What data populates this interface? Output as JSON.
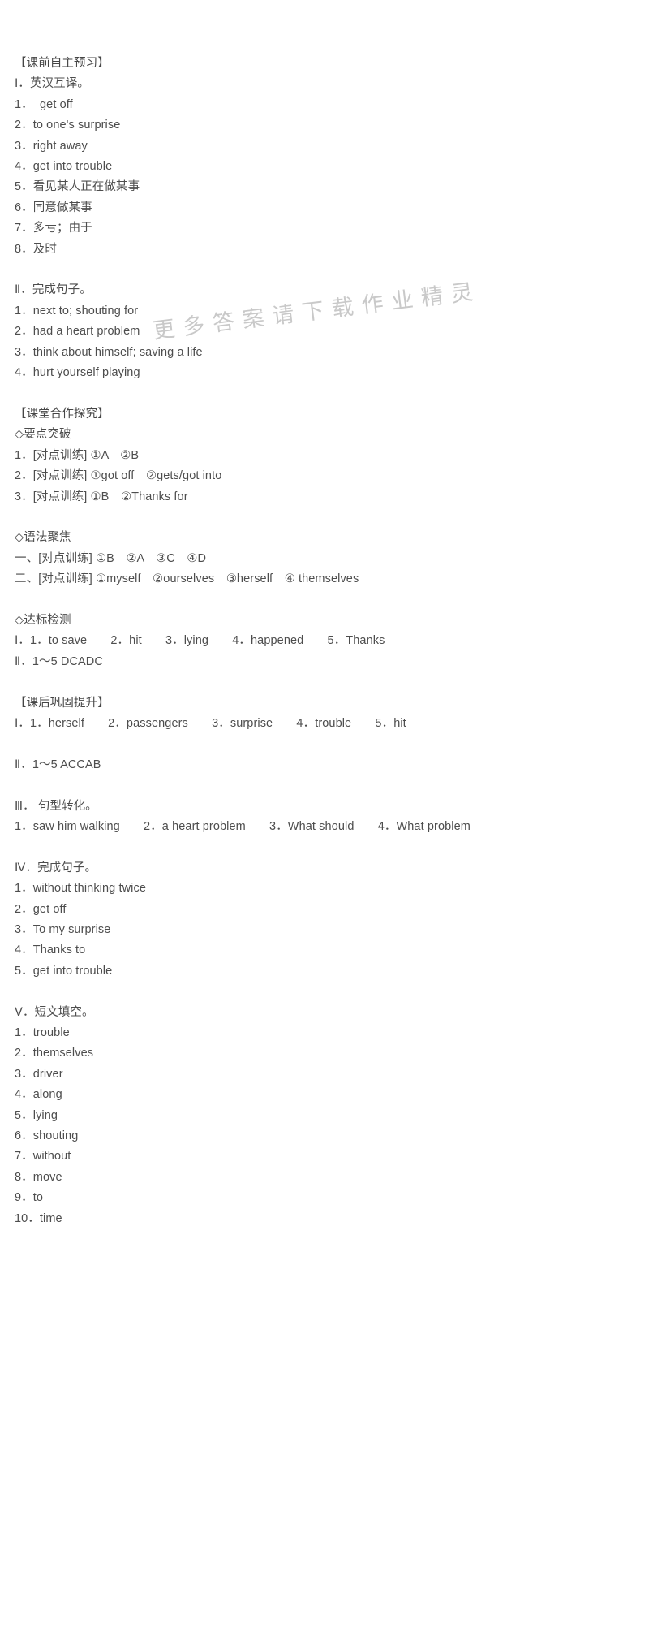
{
  "document": {
    "watermark": "更多答案请下载作业精灵",
    "blocks": [
      {
        "type": "header",
        "text": "【课前自主预习】"
      },
      {
        "type": "sub",
        "text": "Ⅰ．英汉互译。"
      },
      {
        "type": "item",
        "text": "1．  get off"
      },
      {
        "type": "item",
        "text": "2．to one's surprise"
      },
      {
        "type": "item",
        "text": "3．right away"
      },
      {
        "type": "item",
        "text": "4．get into trouble"
      },
      {
        "type": "item",
        "text": "5．看见某人正在做某事"
      },
      {
        "type": "item",
        "text": "6．同意做某事"
      },
      {
        "type": "item",
        "text": "7．多亏；由于"
      },
      {
        "type": "item",
        "text": "8．及时"
      },
      {
        "type": "gap",
        "text": ""
      },
      {
        "type": "sub",
        "text": "Ⅱ．完成句子。"
      },
      {
        "type": "item",
        "text": "1．next to; shouting for"
      },
      {
        "type": "item",
        "text": "2．had a heart problem"
      },
      {
        "type": "item",
        "text": "3．think about himself; saving a life"
      },
      {
        "type": "item",
        "text": "4．hurt yourself playing"
      },
      {
        "type": "gap",
        "text": ""
      },
      {
        "type": "header",
        "text": "【课堂合作探究】"
      },
      {
        "type": "sub",
        "text": "◇要点突破"
      },
      {
        "type": "item",
        "text": "1．[对点训练] ①A　②B"
      },
      {
        "type": "item",
        "text": "2．[对点训练] ①got off　②gets/got into"
      },
      {
        "type": "item",
        "text": "3．[对点训练] ①B　②Thanks for"
      },
      {
        "type": "gap",
        "text": ""
      },
      {
        "type": "sub",
        "text": "◇语法聚焦"
      },
      {
        "type": "item",
        "text": "一、[对点训练] ①B　②A　③C　④D"
      },
      {
        "type": "item",
        "text": "二、[对点训练] ①myself　②ourselves　③herself　④ themselves"
      },
      {
        "type": "gap",
        "text": ""
      },
      {
        "type": "sub",
        "text": "◇达标检测"
      },
      {
        "type": "item",
        "text": "Ⅰ．1．to save　　2．hit　　3．lying　　4．happened　　5．Thanks"
      },
      {
        "type": "item",
        "text": "Ⅱ．1～5 DCADC"
      },
      {
        "type": "gap",
        "text": ""
      },
      {
        "type": "header",
        "text": "【课后巩固提升】"
      },
      {
        "type": "item",
        "text": "Ⅰ．1．herself　　2．passengers　　3．surprise　　4．trouble　　5．hit"
      },
      {
        "type": "gap",
        "text": ""
      },
      {
        "type": "item",
        "text": "Ⅱ．1～5 ACCAB"
      },
      {
        "type": "gap",
        "text": ""
      },
      {
        "type": "sub",
        "text": "Ⅲ． 句型转化。"
      },
      {
        "type": "item",
        "text": "1．saw him walking　　2．a heart problem　　3．What should　　4．What problem"
      },
      {
        "type": "gap",
        "text": ""
      },
      {
        "type": "sub",
        "text": "Ⅳ．完成句子。"
      },
      {
        "type": "item",
        "text": "1．without thinking twice"
      },
      {
        "type": "item",
        "text": "2．get off"
      },
      {
        "type": "item",
        "text": "3．To my surprise"
      },
      {
        "type": "item",
        "text": "4．Thanks to"
      },
      {
        "type": "item",
        "text": "5．get into trouble"
      },
      {
        "type": "gap",
        "text": ""
      },
      {
        "type": "sub",
        "text": "Ⅴ．短文填空。"
      },
      {
        "type": "item",
        "text": "1．trouble"
      },
      {
        "type": "item",
        "text": "2．themselves"
      },
      {
        "type": "item",
        "text": "3．driver"
      },
      {
        "type": "item",
        "text": "4．along"
      },
      {
        "type": "item",
        "text": "5．lying"
      },
      {
        "type": "item",
        "text": "6．shouting"
      },
      {
        "type": "item",
        "text": "7．without"
      },
      {
        "type": "item",
        "text": "8．move"
      },
      {
        "type": "item",
        "text": "9．to"
      },
      {
        "type": "item",
        "text": "10．time"
      }
    ]
  }
}
